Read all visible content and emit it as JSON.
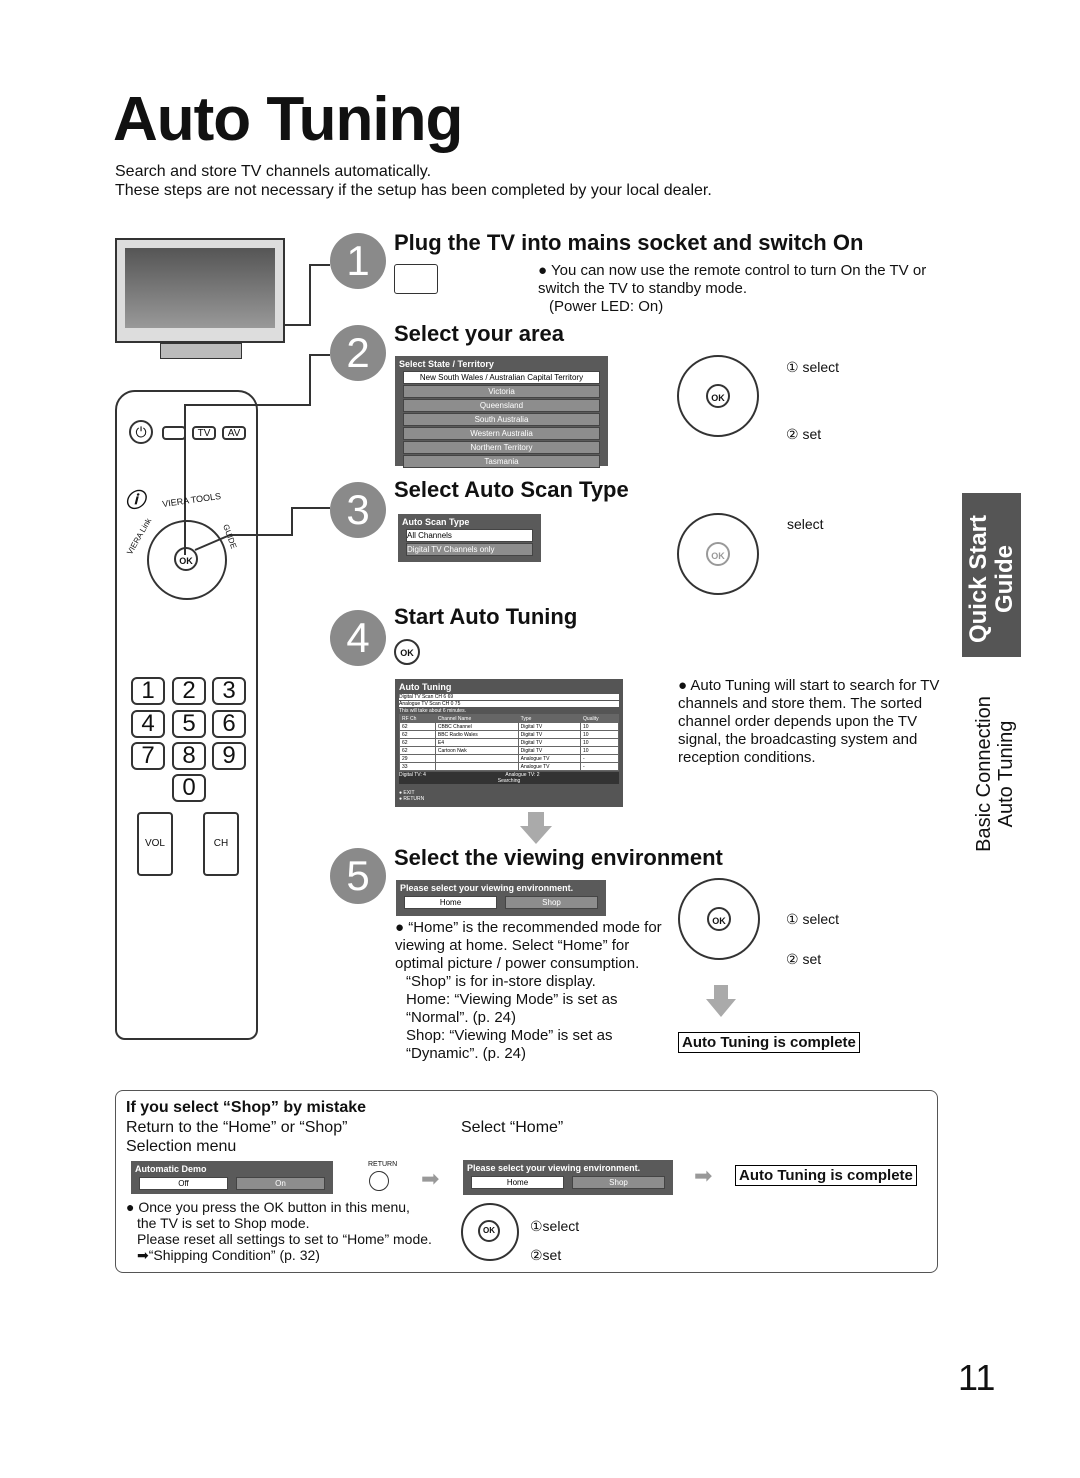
{
  "title": "Auto Tuning",
  "intro": [
    "Search and store TV channels automatically.",
    "These steps are not necessary if the setup has been completed by your local dealer."
  ],
  "steps": [
    {
      "num": "1",
      "heading": "Plug the TV into mains socket and switch On",
      "note": "You can now use the remote control to turn On the TV or switch the TV to standby mode.",
      "note2": "(Power LED: On)"
    },
    {
      "num": "2",
      "heading": "Select your area",
      "menu_title": "Select State / Territory",
      "menu_items": [
        "New South Wales / Australian Capital Territory",
        "Victoria",
        "Queensland",
        "South Australia",
        "Western Australia",
        "Northern Territory",
        "Tasmania"
      ],
      "select": "① select",
      "set": "② set"
    },
    {
      "num": "3",
      "heading": "Select Auto Scan Type",
      "menu_title": "Auto Scan Type",
      "menu_items": [
        "All Channels",
        "Digital TV Channels only"
      ],
      "select": "select"
    },
    {
      "num": "4",
      "heading": "Start Auto Tuning",
      "note": "Auto Tuning will start to search for TV channels and store them. The sorted channel order depends upon the TV signal, the broadcasting system and reception conditions.",
      "screen": {
        "title": "Auto Tuning",
        "scan_rows": [
          {
            "label": "Digital TV Scan",
            "ch": "CH 6",
            "end": "69"
          },
          {
            "label": "Analogue TV Scan",
            "ch": "CH 0",
            "end": "75"
          }
        ],
        "info": "This will take about 6 minutes.",
        "headers": [
          "RF Ch",
          "Channel Name",
          "Type",
          "Quality"
        ],
        "rows": [
          [
            "62",
            "CBBC Channel",
            "Digital TV",
            "10"
          ],
          [
            "62",
            "BBC Radio Wales",
            "Digital TV",
            "10"
          ],
          [
            "62",
            "E4",
            "Digital TV",
            "10"
          ],
          [
            "62",
            "Cartoon Nwk",
            "Digital TV",
            "10"
          ],
          [
            "29",
            "",
            "Analogue TV",
            "-"
          ],
          [
            "33",
            "",
            "Analogue TV",
            "-"
          ]
        ],
        "digital_count": "Digital TV: 4",
        "analogue_count": "Analogue TV: 2",
        "status": "Searching",
        "exit": "EXIT",
        "return": "RETURN"
      }
    },
    {
      "num": "5",
      "heading": "Select the viewing environment",
      "menu_title": "Please select your viewing environment.",
      "options": [
        "Home",
        "Shop"
      ],
      "note": [
        "“Home” is the recommended mode for viewing at home. Select “Home” for optimal picture / power consumption.",
        "“Shop” is for in-store display.",
        "Home: “Viewing Mode” is set as “Normal”. (p. 24)",
        "Shop: “Viewing Mode” is set as “Dynamic”. (p. 24)"
      ],
      "select": "① select",
      "set": "② set",
      "complete": "Auto Tuning is complete"
    }
  ],
  "mistake": {
    "heading": "If you select “Shop” by mistake",
    "line1": "Return to the “Home” or “Shop”",
    "line2": "Selection menu",
    "select_home": "Select “Home”",
    "demo_title": "Automatic Demo",
    "demo_options": [
      "Off",
      "On"
    ],
    "return_label": "RETURN",
    "env_title": "Please select your viewing environment.",
    "env_options": [
      "Home",
      "Shop"
    ],
    "complete": "Auto Tuning is complete",
    "notes": [
      "Once you press the OK button in this menu,",
      "the TV is set to Shop mode.",
      "Please reset all settings to set to “Home” mode.",
      "“Shipping Condition” (p. 32)"
    ],
    "select": "①select",
    "set": "②set"
  },
  "side_tab": {
    "dark": "Quick Start Guide",
    "line1": "Basic Connection",
    "line2": "Auto Tuning"
  },
  "remote": {
    "tv": "TV",
    "av": "AV",
    "viera_tools": "VIERA TOOLS",
    "viera_link": "VIERA Link",
    "guide": "GUIDE",
    "ok": "OK",
    "vol": "VOL",
    "ch": "CH",
    "digits": [
      "1",
      "2",
      "3",
      "4",
      "5",
      "6",
      "7",
      "8",
      "9",
      "0"
    ]
  },
  "page_number": "11"
}
